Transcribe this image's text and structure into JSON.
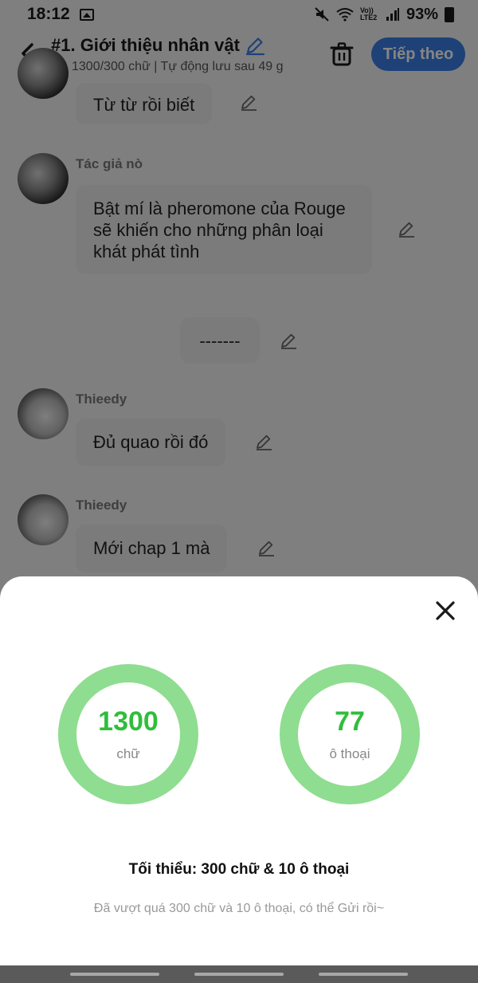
{
  "status_bar": {
    "time": "18:12",
    "battery": "93%",
    "network": "Vo)) LTE2"
  },
  "header": {
    "title": "#1. Giới thiệu nhân vật",
    "subtitle": "1300/300 chữ | Tự động lưu sau 49 g",
    "next_button": "Tiếp theo",
    "accent_color": "#3a7ee4"
  },
  "messages": [
    {
      "sender": "",
      "text": "Từ từ rồi biết"
    },
    {
      "sender": "Tác giả nò",
      "text": "Bật mí là pheromone của Rouge sẽ khiến cho những phân loại khát phát tình"
    },
    {
      "sender": "",
      "text": "-------"
    },
    {
      "sender": "Thieedy",
      "text": "Đủ quao rồi đó"
    },
    {
      "sender": "Thieedy",
      "text": "Mới chap 1 mà"
    }
  ],
  "sheet": {
    "words_count": "1300",
    "words_label": "chữ",
    "dialogues_count": "77",
    "dialogues_label": "ô thoại",
    "minimum_text": "Tối thiểu: 300 chữ & 10 ô thoại",
    "hint_text": "Đã vượt quá 300 chữ và 10 ô thoại, có thể Gửi rồi~",
    "ring_color": "#8fdd90",
    "number_color": "#2fbe3b"
  },
  "icons": {
    "back": "chevron-left-icon",
    "edit": "pencil-icon",
    "delete": "trash-icon",
    "close": "close-icon",
    "saved": "check-circle-icon"
  }
}
